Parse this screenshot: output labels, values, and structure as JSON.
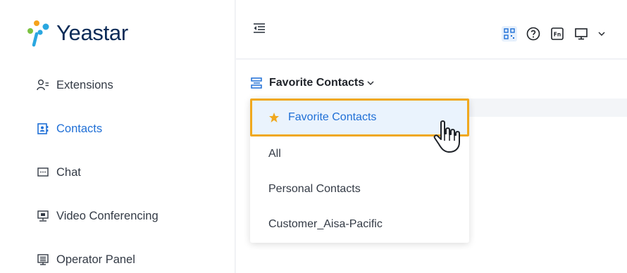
{
  "app": {
    "brand": "Yeastar"
  },
  "colors": {
    "accent": "#1f6fd6",
    "highlight_border": "#f0a81e",
    "brand_text": "#0a2b57"
  },
  "sidebar": {
    "items": [
      {
        "label": "Extensions",
        "icon": "user-list-icon",
        "active": false
      },
      {
        "label": "Contacts",
        "icon": "contact-book-icon",
        "active": true
      },
      {
        "label": "Chat",
        "icon": "chat-icon",
        "active": false
      },
      {
        "label": "Video Conferencing",
        "icon": "video-conference-icon",
        "active": false
      },
      {
        "label": "Operator Panel",
        "icon": "operator-panel-icon",
        "active": false
      }
    ]
  },
  "topbar": {
    "icons": [
      "collapse-menu-icon",
      "qr-code-icon",
      "help-icon",
      "function-key-icon",
      "monitor-icon",
      "chevron-down-icon"
    ]
  },
  "contacts": {
    "selector_label": "Favorite Contacts",
    "dropdown": {
      "options": [
        {
          "label": "Favorite Contacts",
          "selected": true
        },
        {
          "label": "All",
          "selected": false
        },
        {
          "label": "Personal Contacts",
          "selected": false
        },
        {
          "label": "Customer_Aisa-Pacific",
          "selected": false
        }
      ]
    }
  }
}
